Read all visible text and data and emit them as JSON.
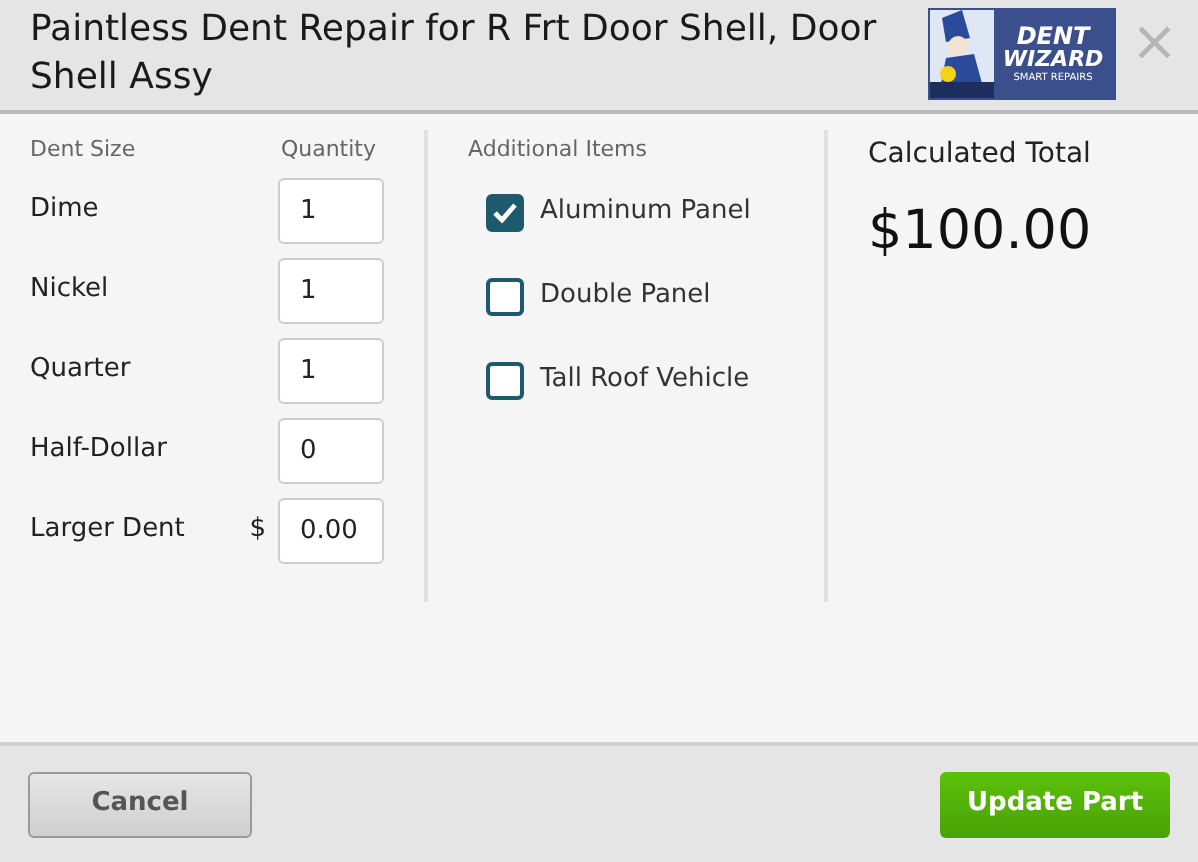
{
  "dialog": {
    "title": "Paintless Dent Repair for R Frt Door Shell, Door Shell Assy",
    "close": "×"
  },
  "logo": {
    "line_1": "DENT",
    "line_2": "WIZARD",
    "tagline": "SMART REPAIRS"
  },
  "dent_table": {
    "columns": [
      "Dent Size",
      "Quantity"
    ],
    "rows": [
      {
        "label": "Dime",
        "value": "1"
      },
      {
        "label": "Nickel",
        "value": "1"
      },
      {
        "label": "Quarter",
        "value": "1"
      },
      {
        "label": "Half-Dollar",
        "value": "0"
      },
      {
        "label": "Larger Dent",
        "prefix": "$",
        "value": "0.00"
      }
    ]
  },
  "additional_items": {
    "heading": "Additional Items",
    "items": [
      {
        "label": "Aluminum Panel",
        "checked": true
      },
      {
        "label": "Double Panel",
        "checked": false
      },
      {
        "label": "Tall Roof Vehicle",
        "checked": false
      }
    ]
  },
  "total": {
    "label": "Calculated Total",
    "value": "$100.00"
  },
  "buttons": {
    "cancel": "Cancel",
    "submit": "Update Part"
  }
}
